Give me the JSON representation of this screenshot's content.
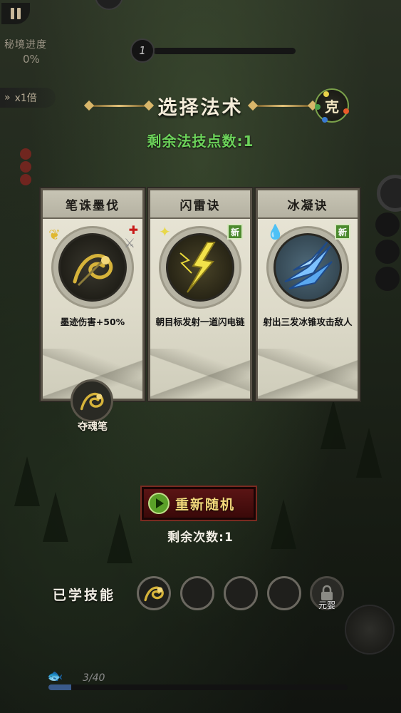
{
  "hud": {
    "progress_label": "秘境进度",
    "progress_value": "0%",
    "speed_label": "x1倍",
    "level": "1",
    "exp_text": "3/40",
    "exp_fraction": 0.075
  },
  "title": "选择法术",
  "ke_badge": "克",
  "skill_points_text": "剩余法技点数:1",
  "cards": [
    {
      "name": "笔诛墨伐",
      "description": "墨迹伤害+50%",
      "is_new": false,
      "tint": "#1b1a16",
      "accent": "#d6b33a"
    },
    {
      "name": "闪雷诀",
      "description": "朝目标发射一道闪电链",
      "is_new": true,
      "new_label": "新",
      "tint": "#2a2716",
      "accent": "#f2e24a"
    },
    {
      "name": "冰凝诀",
      "description": "射出三发冰锥攻击敌人",
      "is_new": true,
      "new_label": "新",
      "tint": "#3f5563",
      "accent": "#5aa8f0"
    }
  ],
  "linked_skill": {
    "label": "夺魂笔"
  },
  "reroll": {
    "label": "重新随机",
    "remaining_text": "剩余次数:1"
  },
  "learned": {
    "label": "已学技能",
    "lock_label": "元婴"
  },
  "colors": {
    "points_green": "#6cd25a",
    "reroll_red": "#5a1414",
    "card_bg": "#e9e6d7"
  }
}
